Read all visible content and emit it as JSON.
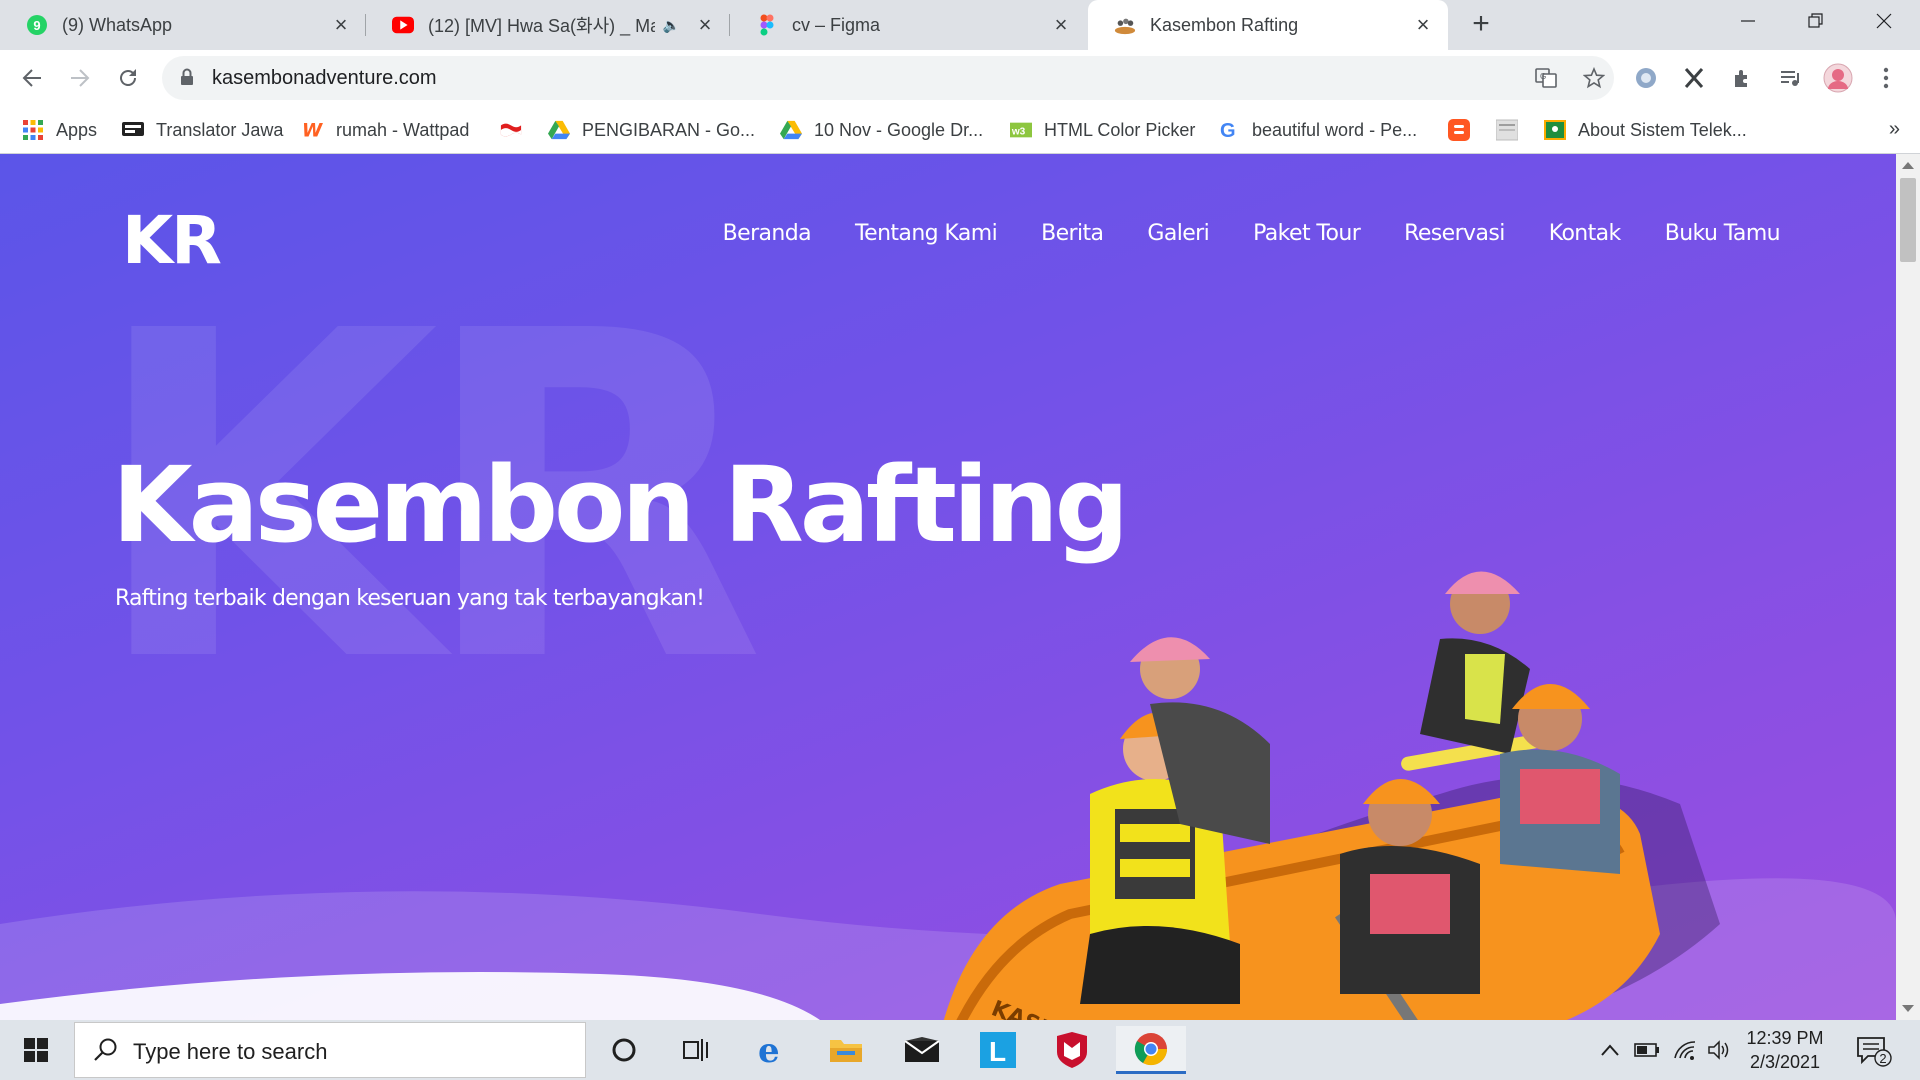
{
  "browser": {
    "tabs": [
      {
        "title": "(9) WhatsApp",
        "icon": "whatsapp-icon",
        "badge": "9"
      },
      {
        "title": "(12) [MV] Hwa Sa(화사) _ Ma",
        "icon": "youtube-icon"
      },
      {
        "title": "cv – Figma",
        "icon": "figma-icon"
      },
      {
        "title": "Kasembon Rafting",
        "icon": "site-favicon",
        "active": true
      }
    ],
    "new_tab": "+",
    "url": "kasembonadventure.com",
    "bookmarks": [
      {
        "label": "Apps",
        "icon": "apps-grid-icon"
      },
      {
        "label": "Translator Jawa",
        "icon": "translator-icon"
      },
      {
        "label": "rumah - Wattpad",
        "icon": "wattpad-icon"
      },
      {
        "label": "",
        "icon": "flag-icon"
      },
      {
        "label": "PENGIBARAN - Go...",
        "icon": "google-drive-icon"
      },
      {
        "label": "10 Nov - Google Dr...",
        "icon": "google-drive-icon"
      },
      {
        "label": "HTML Color Picker",
        "icon": "color-picker-icon"
      },
      {
        "label": "beautiful word - Pe...",
        "icon": "google-icon"
      },
      {
        "label": "",
        "icon": "blogger-icon"
      },
      {
        "label": "",
        "icon": "image-icon"
      },
      {
        "label": "About Sistem Telek...",
        "icon": "classroom-icon"
      }
    ],
    "more_bookmarks": "»"
  },
  "site": {
    "logo": "KR",
    "nav": [
      "Beranda",
      "Tentang Kami",
      "Berita",
      "Galeri",
      "Paket Tour",
      "Reservasi",
      "Kontak",
      "Buku Tamu"
    ],
    "bg_watermark": "KR",
    "hero_title": "Kasembon Rafting",
    "hero_subtitle": "Rafting terbaik dengan keseruan yang tak terbayangkan!",
    "colors": {
      "gradient_start": "#5b55e8",
      "gradient_end": "#9a4fe0",
      "raft": "#f7931e"
    }
  },
  "taskbar": {
    "search_placeholder": "Type here to search",
    "time": "12:39 PM",
    "date": "2/3/2021",
    "notification_count": "2",
    "apps": [
      "cortana-icon",
      "task-view-icon",
      "edge-icon",
      "file-explorer-icon",
      "mail-icon",
      "launcher-l-icon",
      "mcafee-icon",
      "chrome-icon"
    ]
  }
}
